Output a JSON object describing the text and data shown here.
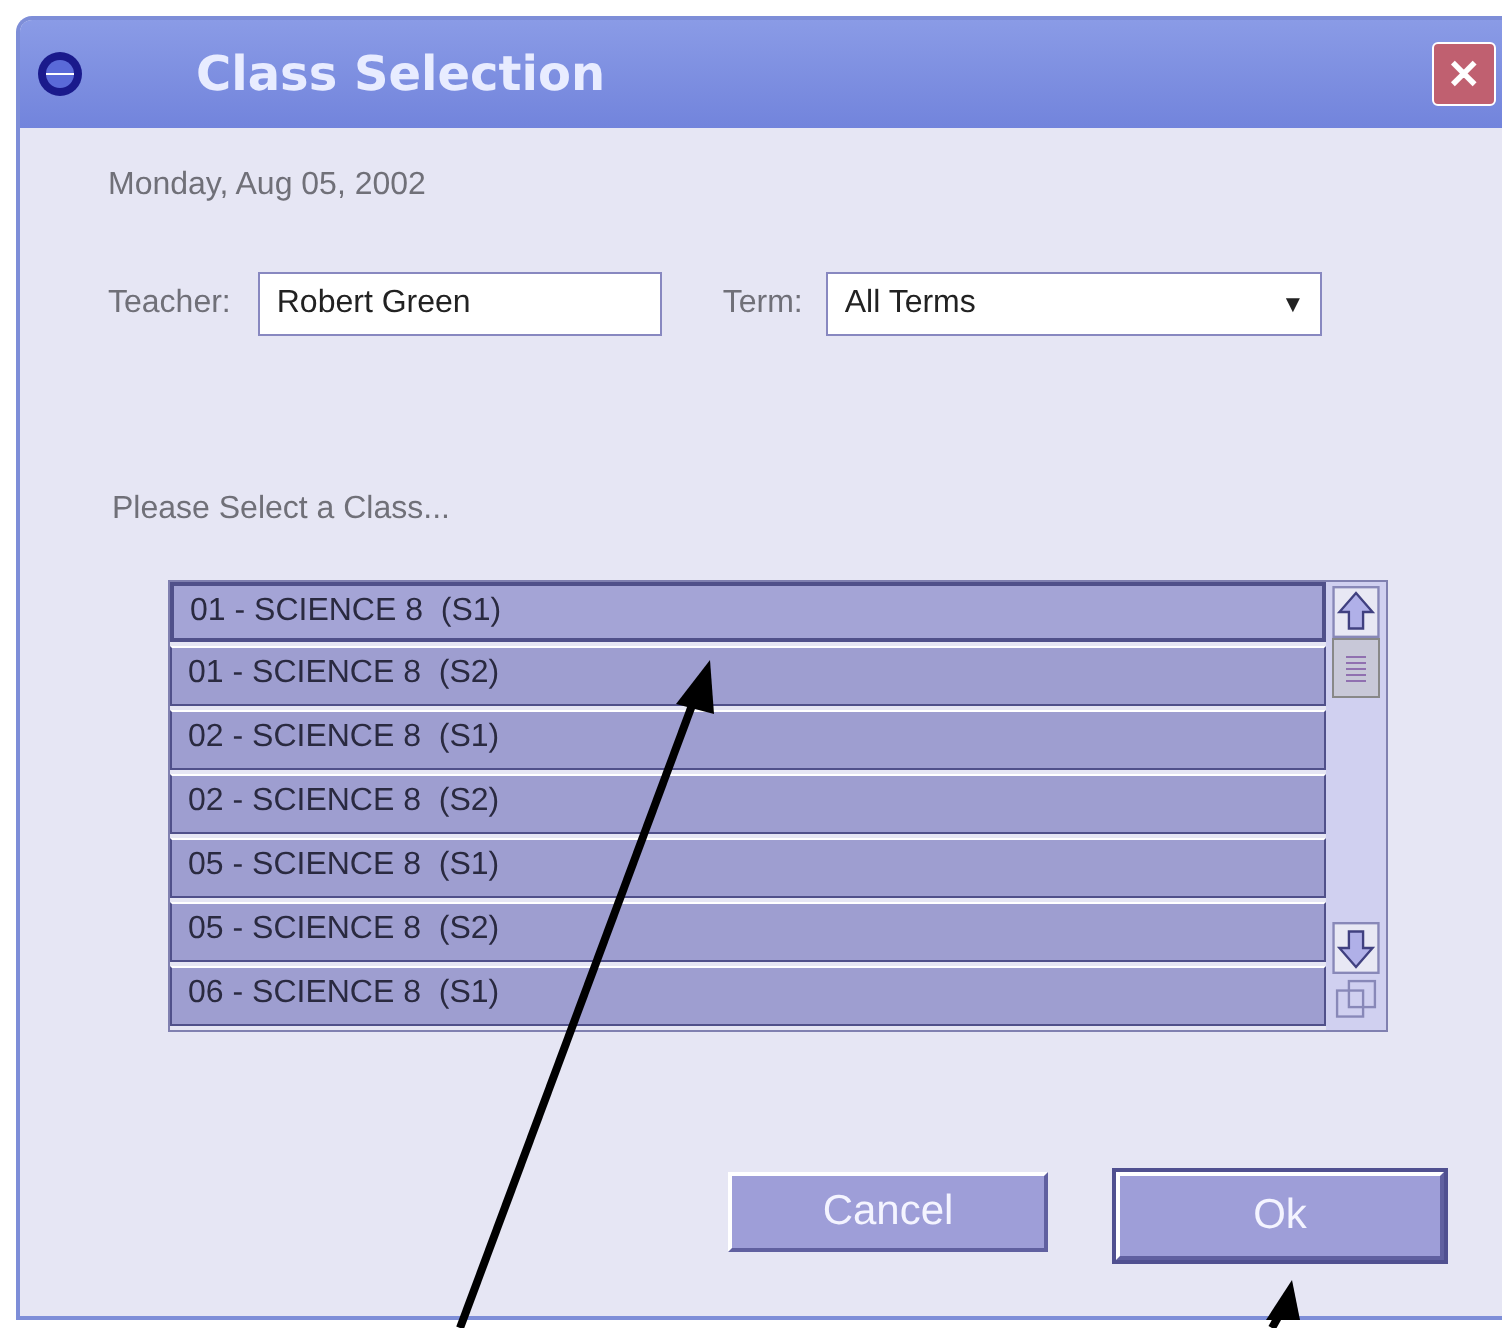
{
  "window": {
    "title": "Class Selection",
    "close": "✕"
  },
  "date": "Monday, Aug 05, 2002",
  "teacher": {
    "label": "Teacher:",
    "value": "Robert Green"
  },
  "term": {
    "label": "Term:",
    "value": "All Terms",
    "arrow": "▼"
  },
  "prompt": "Please Select a Class...",
  "classes": [
    {
      "label": "01 - SCIENCE 8  (S1)",
      "selected": true
    },
    {
      "label": "01 - SCIENCE 8  (S2)",
      "selected": false
    },
    {
      "label": "02 - SCIENCE 8  (S1)",
      "selected": false
    },
    {
      "label": "02 - SCIENCE 8  (S2)",
      "selected": false
    },
    {
      "label": "05 - SCIENCE 8  (S1)",
      "selected": false
    },
    {
      "label": "05 - SCIENCE 8  (S2)",
      "selected": false
    },
    {
      "label": "06 - SCIENCE 8  (S1)",
      "selected": false
    }
  ],
  "buttons": [
    {
      "label": "Cancel",
      "default": false
    },
    {
      "label": "Ok",
      "default": true
    }
  ]
}
